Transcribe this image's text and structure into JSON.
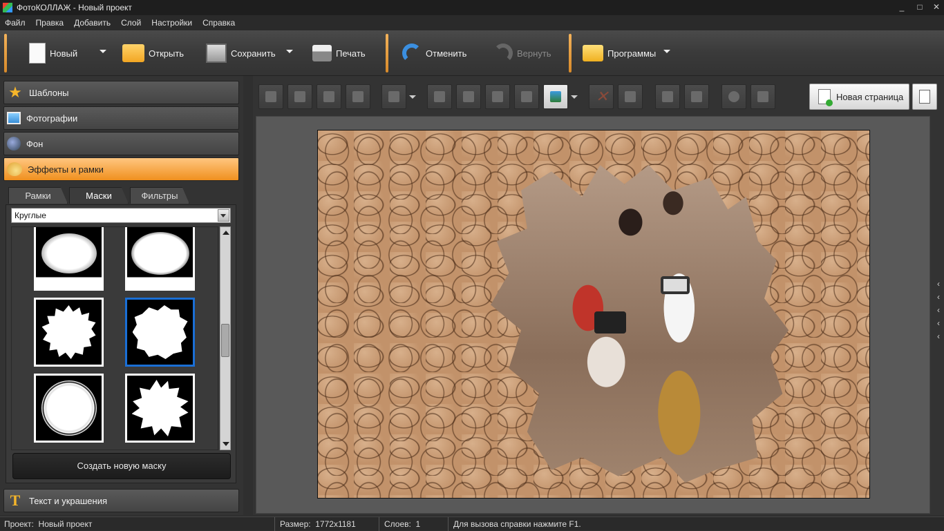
{
  "window": {
    "title": "ФотоКОЛЛАЖ - Новый проект",
    "controls": [
      "_",
      "□",
      "✕"
    ]
  },
  "menu": [
    "Файл",
    "Правка",
    "Добавить",
    "Слой",
    "Настройки",
    "Справка"
  ],
  "toolbar": {
    "new_label": "Новый",
    "open_label": "Открыть",
    "save_label": "Сохранить",
    "print_label": "Печать",
    "undo_label": "Отменить",
    "redo_label": "Вернуть",
    "programs_label": "Программы"
  },
  "sidebar": {
    "sections": [
      {
        "label": "Шаблоны",
        "icon": "star-icon"
      },
      {
        "label": "Фотографии",
        "icon": "photos-icon"
      },
      {
        "label": "Фон",
        "icon": "background-icon"
      },
      {
        "label": "Эффекты и рамки",
        "icon": "palette-icon",
        "active": true
      }
    ],
    "bottom_section": {
      "label": "Текст и украшения",
      "icon": "text-icon"
    },
    "tabs": [
      "Рамки",
      "Маски",
      "Фильтры"
    ],
    "selected_tab": "Маски",
    "category_select": "Круглые",
    "create_mask_label": "Создать новую маску"
  },
  "editor": {
    "new_page_label": "Новая страница",
    "accent_color": "#f0901e",
    "selection_color": "#1a6fd6"
  },
  "status": {
    "project_label": "Проект:",
    "project_value": "Новый проект",
    "size_label": "Размер:",
    "size_value": "1772x1181",
    "layers_label": "Слоев:",
    "layers_value": "1",
    "help_text": "Для вызова справки нажмите F1."
  }
}
